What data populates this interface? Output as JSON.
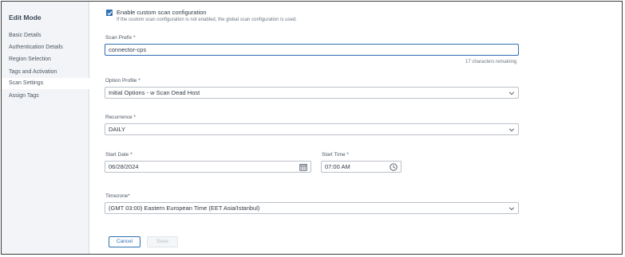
{
  "sidebar": {
    "title": "Edit Mode",
    "items": [
      {
        "label": "Basic Details"
      },
      {
        "label": "Authentication Details"
      },
      {
        "label": "Region Selection"
      },
      {
        "label": "Tags and Activation"
      },
      {
        "label": "Scan Settings"
      },
      {
        "label": "Assign Tags"
      }
    ]
  },
  "custom_scan": {
    "checked": true,
    "label": "Enable custom scan configuration",
    "help": "If the custom scan configuration is not enabled, the global scan configuration is used."
  },
  "scan_prefix": {
    "label": "Scan Prefix *",
    "value": "connector-cps",
    "remaining": "17 characters remaining"
  },
  "option_profile": {
    "label": "Option Profile *",
    "value": "Initial Options - w Scan Dead Host"
  },
  "recurrence": {
    "label": "Recurrence *",
    "value": "DAILY"
  },
  "start_date": {
    "label": "Start Date *",
    "value": "06/28/2024"
  },
  "start_time": {
    "label": "Start Time *",
    "value": "07:00 AM"
  },
  "timezone": {
    "label": "Timezone*",
    "value": "(GMT 03:00) Eastern European Time (EET Asia/Istanbul)"
  },
  "actions": {
    "cancel": "Cancel",
    "save": "Save"
  },
  "colors": {
    "accent": "#2f6fb3",
    "sidebar_bg": "#f2f4f7"
  }
}
